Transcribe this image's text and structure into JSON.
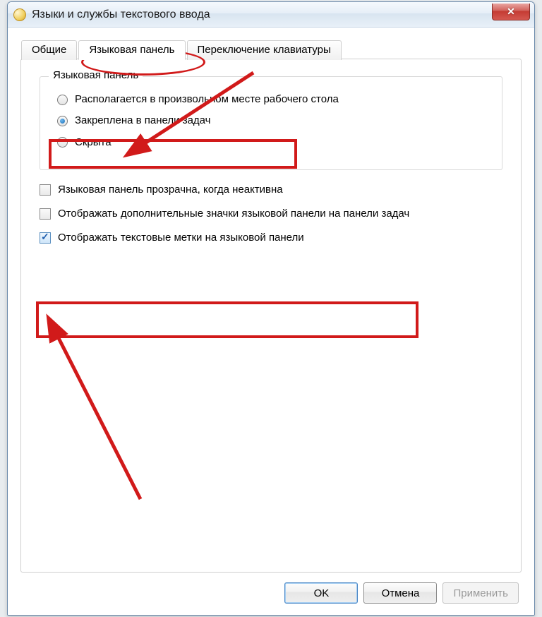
{
  "window": {
    "title": "Языки и службы текстового ввода"
  },
  "tabs": {
    "general": "Общие",
    "langbar": "Языковая панель",
    "keyswitch": "Переключение клавиатуры"
  },
  "group": {
    "title": "Языковая панель",
    "radio_float": "Располагается в произвольном месте рабочего стола",
    "radio_docked": "Закреплена в панели задач",
    "radio_hidden": "Скрыта"
  },
  "checks": {
    "transparent": "Языковая панель прозрачна, когда неактивна",
    "extra_icons": "Отображать дополнительные значки языковой панели на панели задач",
    "text_labels": "Отображать текстовые метки на языковой панели"
  },
  "buttons": {
    "ok": "OK",
    "cancel": "Отмена",
    "apply": "Применить"
  }
}
